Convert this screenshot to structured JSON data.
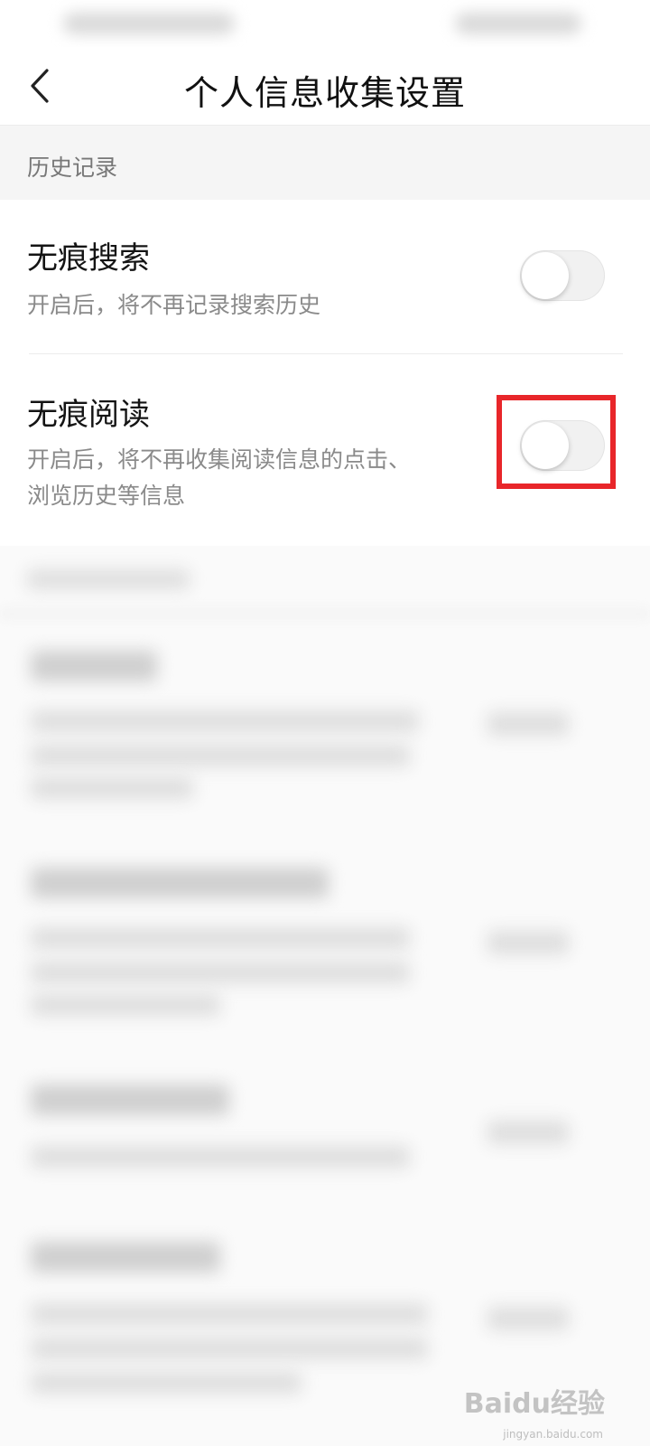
{
  "header": {
    "title": "个人信息收集设置",
    "back_icon": "chevron-left-icon"
  },
  "section": {
    "label": "历史记录"
  },
  "settings": [
    {
      "title": "无痕搜索",
      "description": "开启后，将不再记录搜索历史",
      "enabled": false
    },
    {
      "title": "无痕阅读",
      "description_line1": "开启后，将不再收集阅读信息的点击、",
      "description_line2": "浏览历史等信息",
      "enabled": false
    }
  ],
  "annotation": {
    "highlight_color": "#e8262a"
  },
  "watermark": {
    "text": "Baidu经验",
    "url_text": "jingyan.baidu.com"
  },
  "colors": {
    "section_bg": "#f5f5f5",
    "toggle_off": "#f1f1f1"
  }
}
